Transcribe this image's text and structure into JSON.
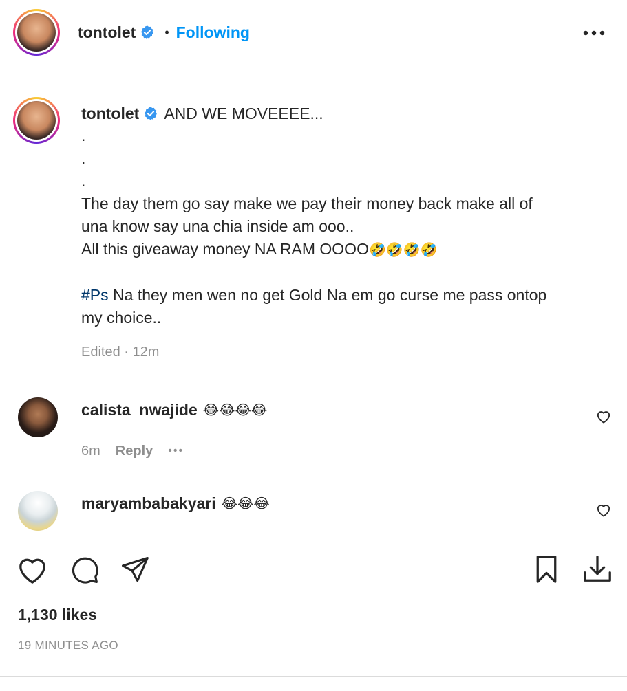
{
  "header": {
    "username": "tontolet",
    "separator": "•",
    "follow_label": "Following",
    "more_icon": "more-horizontal-icon"
  },
  "caption": {
    "username": "tontolet",
    "title_text": "AND WE MOVEEEE...",
    "dots": [
      ".",
      ".",
      "."
    ],
    "line1": "The day them go say make we pay their money back make all of",
    "line2": "una know say una chia inside am ooo..",
    "line3_text": "All this giveaway money NA RAM OOOO",
    "line3_emoji": "🤣🤣🤣🤣",
    "hashtag": "#Ps",
    "ps_text": " Na they men wen no get Gold Na em go curse me pass ontop",
    "ps_line2": "my choice..",
    "meta": "Edited · 12m"
  },
  "comments": [
    {
      "username": "calista_nwajide",
      "emoji": "😂😂😂😂",
      "time": "6m",
      "reply_label": "Reply",
      "more": "•••"
    },
    {
      "username": "maryambabakyari",
      "emoji": "😂😂😂"
    }
  ],
  "actions": {
    "like_icon": "heart-icon",
    "comment_icon": "comment-icon",
    "share_icon": "send-icon",
    "save_icon": "bookmark-icon",
    "download_icon": "download-icon"
  },
  "stats": {
    "likes": "1,130 likes",
    "posted": "19 MINUTES AGO"
  }
}
